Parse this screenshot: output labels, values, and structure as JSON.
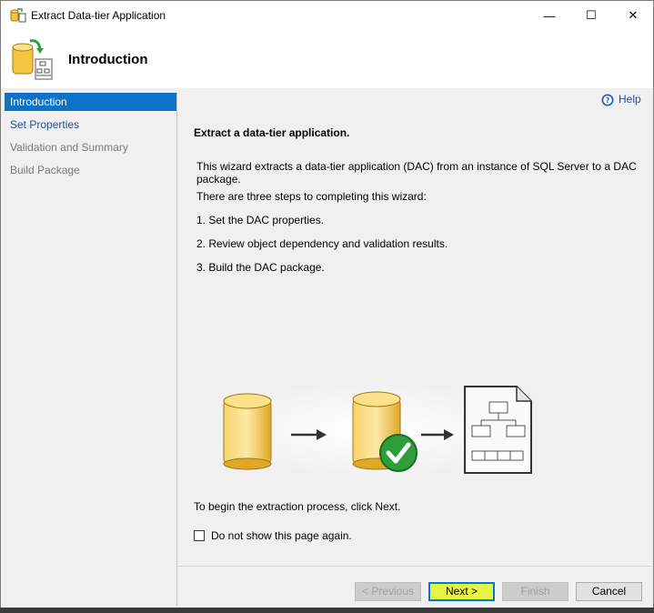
{
  "window": {
    "title": "Extract Data-tier Application"
  },
  "titlebar_buttons": {
    "minimize": "—",
    "maximize": "☐",
    "close": "✕"
  },
  "header": {
    "title": "Introduction"
  },
  "sidebar": {
    "items": [
      {
        "label": "Introduction",
        "state": "active"
      },
      {
        "label": "Set Properties",
        "state": "link"
      },
      {
        "label": "Validation and Summary",
        "state": "disabled"
      },
      {
        "label": "Build Package",
        "state": "disabled"
      }
    ]
  },
  "content": {
    "help_label": "Help",
    "heading": "Extract a data-tier application.",
    "description": "This wizard extracts a data-tier application (DAC) from an instance of SQL Server to a DAC package.",
    "steps_intro": "There are three steps to completing this wizard:",
    "steps": [
      "1. Set the DAC properties.",
      "2. Review object dependency and validation results.",
      "3. Build the DAC package."
    ],
    "begin_text": "To begin the extraction process, click Next.",
    "checkbox_label": "Do not show this page again.",
    "checkbox_checked": false
  },
  "buttons": {
    "previous": "< Previous",
    "next": "Next >",
    "finish": "Finish",
    "cancel": "Cancel"
  },
  "colors": {
    "accent": "#0c72c8",
    "next_highlight": "#e6f542",
    "db_yellow": "#f5c542",
    "check_green": "#2e9e3a"
  }
}
